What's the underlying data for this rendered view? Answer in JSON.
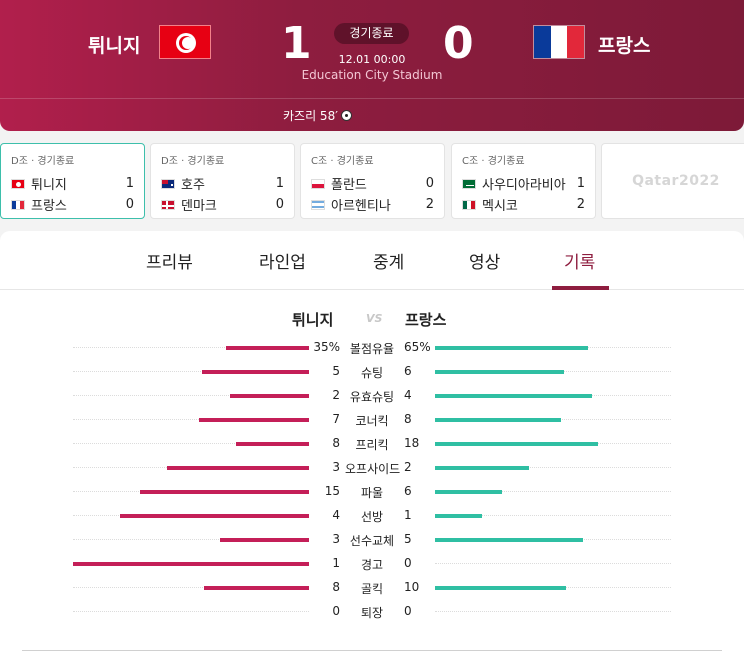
{
  "match": {
    "home": {
      "name": "튀니지",
      "score": "1"
    },
    "away": {
      "name": "프랑스",
      "score": "0"
    },
    "status": "경기종료",
    "time": "12.01 00:00",
    "stadium": "Education City Stadium",
    "scorer": "카즈리 58′"
  },
  "other_matches": [
    {
      "group": "D조 · 경기종료",
      "home": "튀니지",
      "home_score": "1",
      "away": "프랑스",
      "away_score": "0",
      "active": true
    },
    {
      "group": "D조 · 경기종료",
      "home": "호주",
      "home_score": "1",
      "away": "덴마크",
      "away_score": "0",
      "active": false
    },
    {
      "group": "C조 · 경기종료",
      "home": "폴란드",
      "home_score": "0",
      "away": "아르헨티나",
      "away_score": "2",
      "active": false
    },
    {
      "group": "C조 · 경기종료",
      "home": "사우디아라비아",
      "home_score": "1",
      "away": "멕시코",
      "away_score": "2",
      "active": false
    }
  ],
  "logo_text": "Qatar2022",
  "tabs": [
    "프리뷰",
    "라인업",
    "중계",
    "영상",
    "기록"
  ],
  "active_tab": "기록",
  "stats_header": {
    "home": "튀니지",
    "vs": "VS",
    "away": "프랑스"
  },
  "colors": {
    "home_bar": "#c41f58",
    "away_bar": "#2fbfa3",
    "accent": "#8e1d3f"
  },
  "stats": [
    {
      "label": "볼점유율",
      "home": "35%",
      "away": "65%",
      "home_val": 35,
      "away_val": 65
    },
    {
      "label": "슈팅",
      "home": "5",
      "away": "6",
      "home_val": 5,
      "away_val": 6
    },
    {
      "label": "유효슈팅",
      "home": "2",
      "away": "4",
      "home_val": 2,
      "away_val": 4
    },
    {
      "label": "코너킥",
      "home": "7",
      "away": "8",
      "home_val": 7,
      "away_val": 8
    },
    {
      "label": "프리킥",
      "home": "8",
      "away": "18",
      "home_val": 8,
      "away_val": 18
    },
    {
      "label": "오프사이드",
      "home": "3",
      "away": "2",
      "home_val": 3,
      "away_val": 2
    },
    {
      "label": "파울",
      "home": "15",
      "away": "6",
      "home_val": 15,
      "away_val": 6
    },
    {
      "label": "선방",
      "home": "4",
      "away": "1",
      "home_val": 4,
      "away_val": 1
    },
    {
      "label": "선수교체",
      "home": "3",
      "away": "5",
      "home_val": 3,
      "away_val": 5
    },
    {
      "label": "경고",
      "home": "1",
      "away": "0",
      "home_val": 1,
      "away_val": 0
    },
    {
      "label": "골킥",
      "home": "8",
      "away": "10",
      "home_val": 8,
      "away_val": 10
    },
    {
      "label": "퇴장",
      "home": "0",
      "away": "0",
      "home_val": 0,
      "away_val": 0
    }
  ]
}
